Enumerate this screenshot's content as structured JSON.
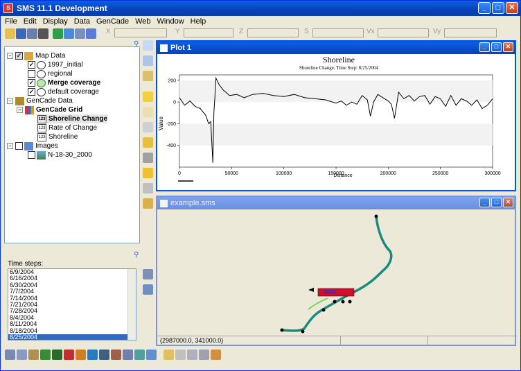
{
  "window": {
    "title": "SMS 11.1 Development"
  },
  "menu": [
    "File",
    "Edit",
    "Display",
    "Data",
    "GenCade",
    "Web",
    "Window",
    "Help"
  ],
  "coords": {
    "x_label": "X",
    "y_label": "Y",
    "z_label": "Z",
    "s_label": "S",
    "vx_label": "Vx",
    "vy_label": "Vy"
  },
  "tree": {
    "map_data": "Map Data",
    "initial": "1997_initial",
    "regional": "regional",
    "merge": "Merge coverage",
    "default": "default coverage",
    "gencade_data": "GenCade Data",
    "gencade_grid": "GenCade Grid",
    "shoreline_change": "Shoreline Change",
    "rate_of_change": "Rate of Change",
    "shoreline": "Shoreline",
    "images": "Images",
    "image1": "N-18-30_2000",
    "badge": "123"
  },
  "timesteps": {
    "label": "Time steps:",
    "items": [
      "6/9/2004",
      "6/16/2004",
      "6/30/2004",
      "7/7/2004",
      "7/14/2004",
      "7/21/2004",
      "7/28/2004",
      "8/4/2004",
      "8/11/2004",
      "8/18/2004",
      "8/25/2004"
    ],
    "selected": "8/25/2004"
  },
  "plot_window": {
    "title": "Plot 1"
  },
  "sms_window": {
    "title": "example.sms"
  },
  "status": {
    "coordinates": "(2987000.0, 341000.0)"
  },
  "chart_data": {
    "type": "line",
    "title": "Shoreline",
    "subtitle": "Shoreline Change, Time Step: 8/25/2004",
    "xlabel": "Distance",
    "ylabel": "Value",
    "xlim": [
      0,
      300000
    ],
    "ylim": [
      -600,
      250
    ],
    "xticks": [
      0,
      50000,
      100000,
      150000,
      200000,
      250000,
      300000
    ],
    "yticks": [
      200,
      0,
      -200,
      -400
    ],
    "series": [
      {
        "x": [
          0,
          5000,
          10000,
          15000,
          20000,
          25000,
          28000,
          30000,
          32000,
          33000,
          34000,
          35000,
          36000,
          38000,
          42000,
          48000,
          55000,
          62000,
          70000,
          80000,
          90000,
          100000,
          110000,
          120000,
          130000,
          140000,
          150000,
          155000,
          160000,
          165000,
          170000,
          175000,
          180000,
          183000,
          186000,
          190000,
          195000,
          200000,
          203000,
          206000,
          210000,
          215000,
          220000,
          225000,
          230000,
          235000,
          240000,
          245000,
          250000,
          255000,
          260000,
          265000,
          270000,
          275000,
          280000,
          285000,
          290000,
          295000,
          300000
        ],
        "y": [
          40,
          -30,
          10,
          -40,
          -60,
          -120,
          -200,
          -180,
          -560,
          -100,
          50,
          220,
          200,
          160,
          110,
          60,
          70,
          40,
          70,
          80,
          60,
          50,
          70,
          40,
          30,
          20,
          -10,
          10,
          -30,
          0,
          -20,
          60,
          20,
          -130,
          0,
          70,
          40,
          10,
          -20,
          -150,
          90,
          30,
          60,
          10,
          50,
          60,
          -20,
          50,
          30,
          -40,
          60,
          -30,
          30,
          10,
          -30,
          20,
          -60,
          -30,
          30
        ]
      }
    ]
  }
}
